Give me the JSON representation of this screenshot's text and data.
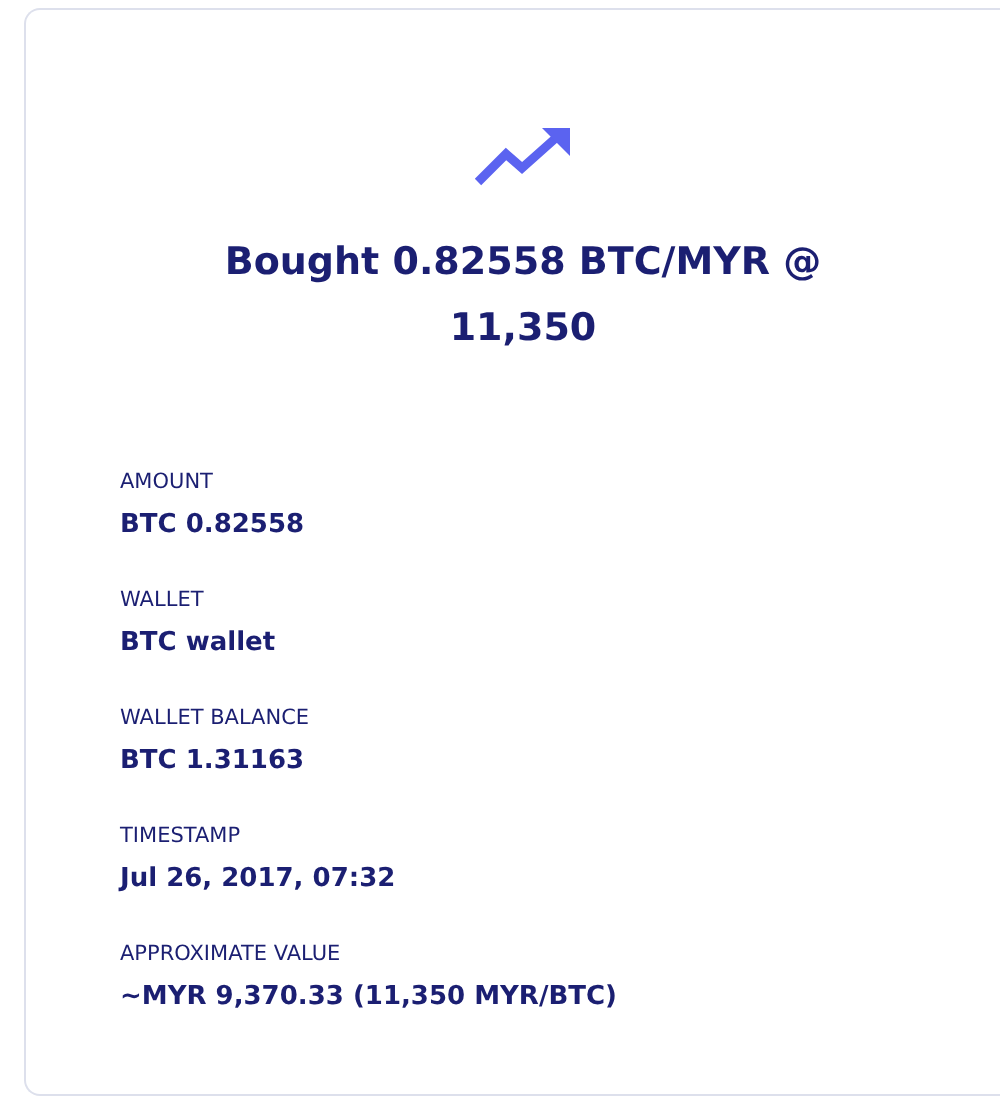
{
  "trade": {
    "title": "Bought 0.82558 BTC/MYR @ 11,350"
  },
  "fields": [
    {
      "label": "AMOUNT",
      "value": "BTC 0.82558"
    },
    {
      "label": "WALLET",
      "value": "BTC wallet"
    },
    {
      "label": "WALLET BALANCE",
      "value": "BTC 1.31163"
    },
    {
      "label": "TIMESTAMP",
      "value": "Jul 26, 2017, 07:32"
    },
    {
      "label": "APPROXIMATE VALUE",
      "value": "~MYR 9,370.33 (11,350 MYR/BTC)"
    }
  ]
}
